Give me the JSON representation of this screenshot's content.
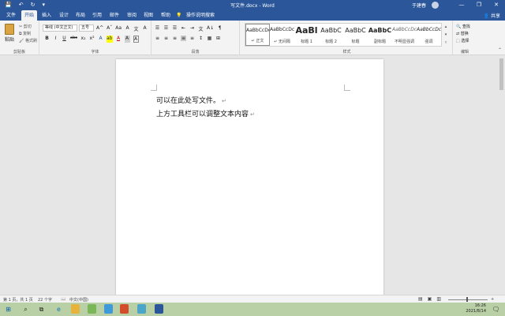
{
  "titlebar": {
    "title": "写文件.docx - Word",
    "user": "于建春",
    "quick_access": [
      "💾",
      "↶",
      "↻",
      "▾"
    ],
    "window_controls": [
      "—",
      "❐",
      "✕"
    ]
  },
  "tabs": [
    "文件",
    "开始",
    "插入",
    "设计",
    "布局",
    "引用",
    "邮件",
    "审阅",
    "视图",
    "帮助",
    "操作说明搜索"
  ],
  "active_tab": "开始",
  "share_label": "共享",
  "ribbon": {
    "clipboard": {
      "paste": "粘贴",
      "cut": "剪切",
      "copy": "复制",
      "format_painter": "格式刷",
      "label": "剪贴板"
    },
    "font": {
      "family": "等线 (中文正文)",
      "size": "五号",
      "label": "字体",
      "row1": [
        "A^",
        "Aˇ",
        "Aa",
        "A",
        "文",
        "A"
      ],
      "row2": [
        "B",
        "I",
        "U",
        "abc",
        "x₂",
        "x²",
        "A",
        "ab",
        "A",
        "A",
        "A"
      ]
    },
    "paragraph": {
      "label": "段落",
      "row1": [
        "☰",
        "☰",
        "☰",
        "⇤",
        "⇥",
        "文",
        "A↓",
        "¶"
      ],
      "row2": [
        "≡",
        "≡",
        "≡",
        "≡",
        "≡",
        "↕",
        "▦",
        "⊞"
      ]
    },
    "styles": {
      "label": "样式",
      "items": [
        {
          "sample": "AaBbCcDc",
          "name": "↵ 正文"
        },
        {
          "sample": "AaBbCcDc",
          "name": "↵ 无间隔"
        },
        {
          "sample": "AaBl",
          "name": "标题 1"
        },
        {
          "sample": "AaBbC",
          "name": "标题 2"
        },
        {
          "sample": "AaBbC",
          "name": "标题"
        },
        {
          "sample": "AaBbC",
          "name": "副标题"
        },
        {
          "sample": "AaBbCcDc",
          "name": "不明显强调"
        },
        {
          "sample": "AaBbCcDc",
          "name": "强调"
        }
      ]
    },
    "editing": {
      "label": "编辑",
      "find": "查找",
      "replace": "替换",
      "select": "选择"
    }
  },
  "document": {
    "lines": [
      "可以在此处写文件。",
      "上方工具栏可以调整文本内容"
    ],
    "para_mark": "↵"
  },
  "statusbar": {
    "page": "第 1 页，共 1 页",
    "words": "22 个字",
    "language": "中文(中国)",
    "zoom": "+"
  },
  "taskbar": {
    "time": "16:26",
    "date": "2021/8/14"
  },
  "colors": {
    "word_blue": "#2b579a",
    "ribbon_bg": "#f3f3f3",
    "taskbar": "#b9cfa5"
  }
}
